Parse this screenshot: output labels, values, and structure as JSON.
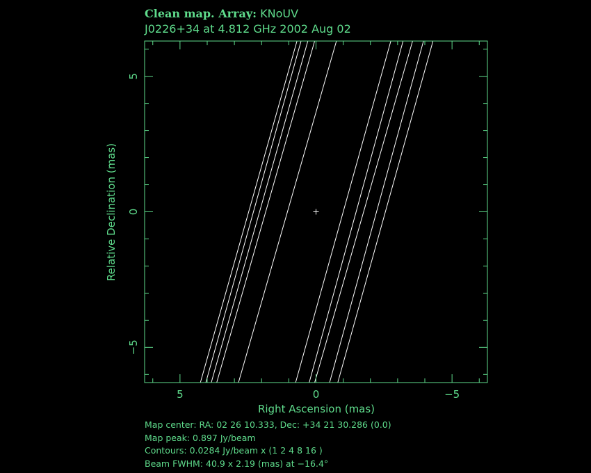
{
  "title_line1_bold": "Clean map.  Array:",
  "title_line1_array": " KNoUV",
  "title_line2": "J0226+34 at 4.812 GHz 2002 Aug 02",
  "footer": {
    "map_center": "Map center:  RA: 02 26 10.333,  Dec: +34 21 30.286 (0.0)",
    "map_peak": "Map peak: 0.897 Jy/beam",
    "contours": "Contours: 0.0284 Jy/beam x (1 2 4 8 16 )",
    "beam": "Beam FWHM: 40.9 x 2.19 (mas) at −16.4°"
  },
  "colors": {
    "axes": "#5fdc8c",
    "contours": "#ffffff",
    "background": "#000000"
  },
  "chart_data": {
    "type": "contour",
    "xlabel": "Right Ascension   (mas)",
    "ylabel": "Relative Declination   (mas)",
    "xlim": [
      6.3,
      -6.3
    ],
    "ylim": [
      -6.3,
      6.3
    ],
    "x_ticks": [
      5,
      0,
      -5
    ],
    "x_tick_labels": [
      "5",
      "0",
      "−5"
    ],
    "y_ticks": [
      5,
      0,
      -5
    ],
    "y_tick_labels": [
      "5",
      "0",
      "−5"
    ],
    "center_marker": [
      0,
      0
    ],
    "contour_lines": [
      {
        "x_bottom": 4.25,
        "x_top": 0.7
      },
      {
        "x_bottom": 4.05,
        "x_top": 0.55
      },
      {
        "x_bottom": 3.85,
        "x_top": 0.3
      },
      {
        "x_bottom": 3.65,
        "x_top": 0.05
      },
      {
        "x_bottom": 2.85,
        "x_top": -0.75
      },
      {
        "x_bottom": 0.75,
        "x_top": -2.75
      },
      {
        "x_bottom": 0.25,
        "x_top": -3.2
      },
      {
        "x_bottom": 0.05,
        "x_top": -3.55
      },
      {
        "x_bottom": -0.5,
        "x_top": -3.95
      },
      {
        "x_bottom": -0.8,
        "x_top": -4.3
      }
    ]
  }
}
